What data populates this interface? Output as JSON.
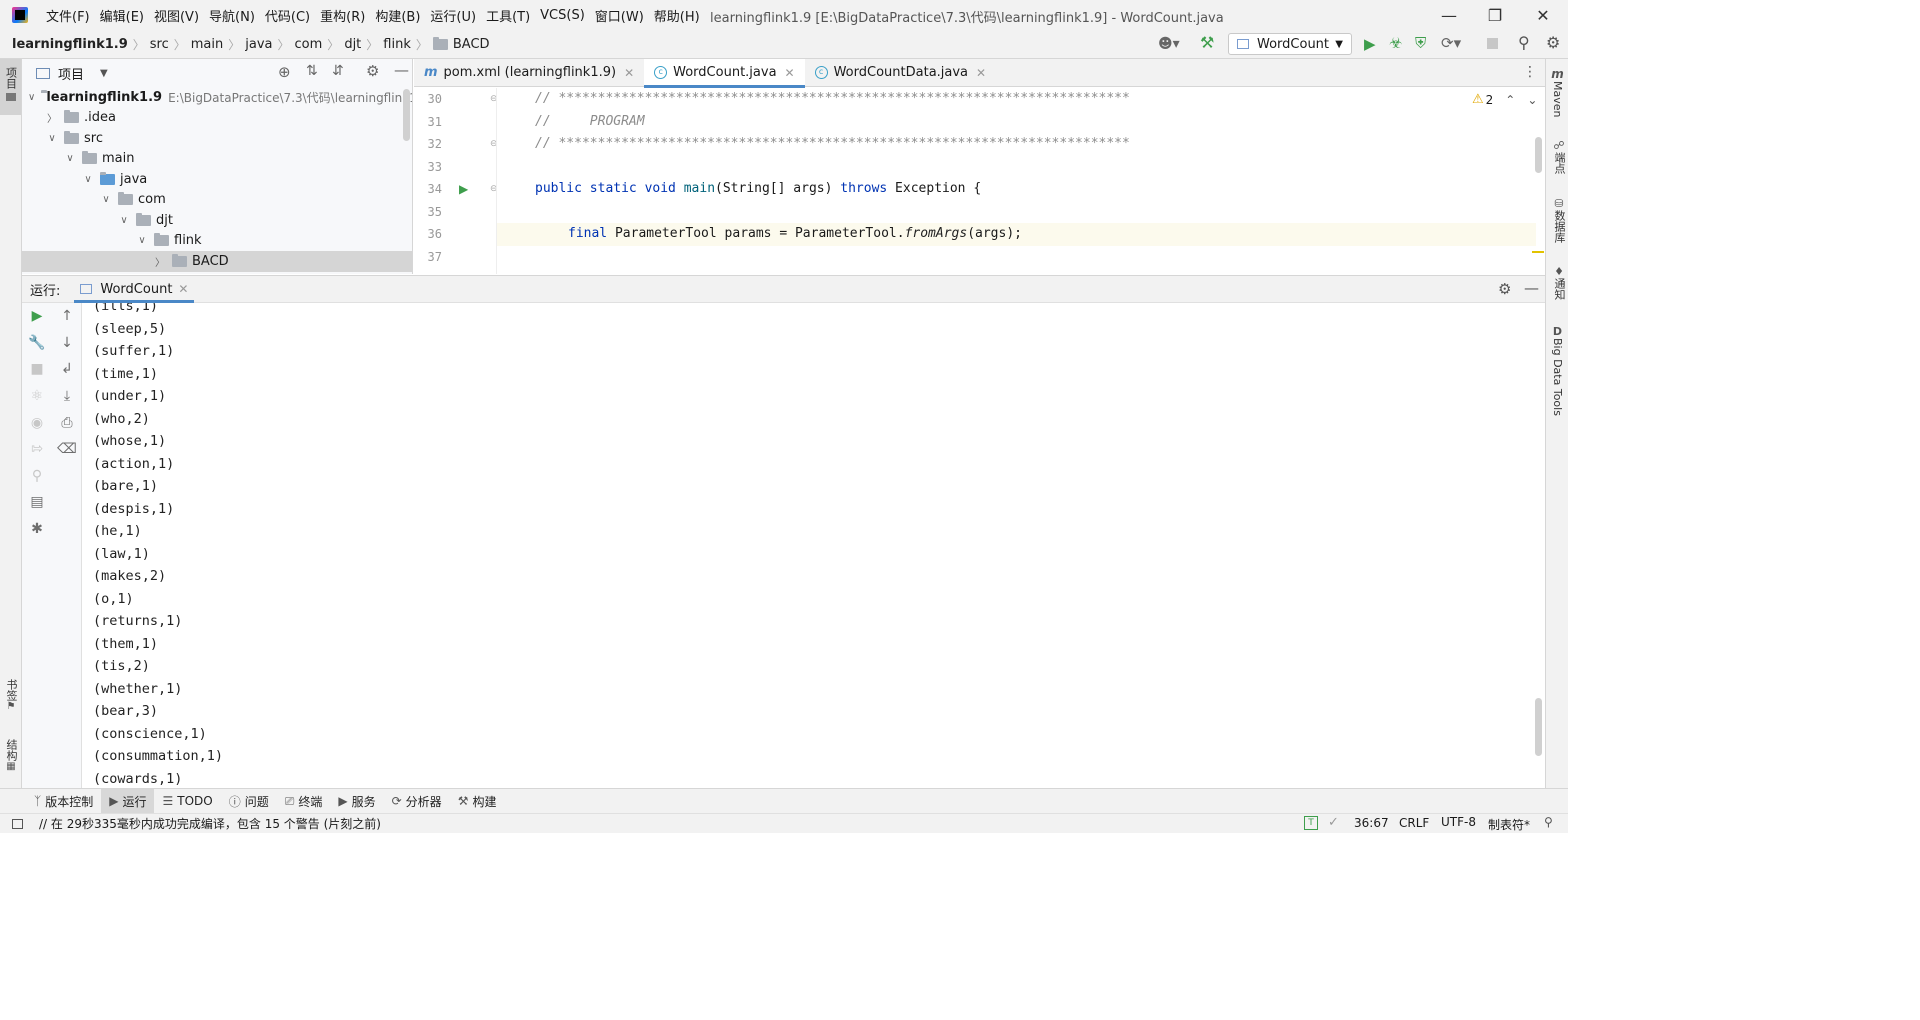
{
  "menu": [
    "文件(F)",
    "编辑(E)",
    "视图(V)",
    "导航(N)",
    "代码(C)",
    "重构(R)",
    "构建(B)",
    "运行(U)",
    "工具(T)",
    "VCS(S)",
    "窗口(W)",
    "帮助(H)"
  ],
  "window_title": "learningflink1.9 [E:\\BigDataPractice\\7.3\\代码\\learningflink1.9] - WordCount.java",
  "breadcrumb": [
    "learningflink1.9",
    "src",
    "main",
    "java",
    "com",
    "djt",
    "flink",
    "BACD"
  ],
  "run_config": "WordCount",
  "project_panel": {
    "title": "项目"
  },
  "tree": [
    {
      "label": "learningflink1.9",
      "path": "E:\\BigDataPractice\\7.3\\代码\\learningflink1",
      "level": 0,
      "chev": "v"
    },
    {
      "label": ".idea",
      "level": 1,
      "chev": ">"
    },
    {
      "label": "src",
      "level": 1,
      "chev": "v"
    },
    {
      "label": "main",
      "level": 2,
      "chev": "v"
    },
    {
      "label": "java",
      "level": 3,
      "chev": "v"
    },
    {
      "label": "com",
      "level": 4,
      "chev": "v"
    },
    {
      "label": "djt",
      "level": 5,
      "chev": "v"
    },
    {
      "label": "flink",
      "level": 6,
      "chev": "v"
    },
    {
      "label": "BACD",
      "level": 7,
      "chev": ">"
    }
  ],
  "tabs": [
    {
      "label": "pom.xml (learningflink1.9)",
      "icon": "m"
    },
    {
      "label": "WordCount.java",
      "icon": "c"
    },
    {
      "label": "WordCountData.java",
      "icon": "c"
    }
  ],
  "warnings_count": "2",
  "line_numbers": [
    "30",
    "31",
    "32",
    "33",
    "34",
    "35",
    "36",
    "37"
  ],
  "code": {
    "l30": "// *************************************************************************",
    "l31": "//     PROGRAM",
    "l32": "// *************************************************************************",
    "l34_kw": "public static void ",
    "l34_fn": "main",
    "l34_a": "(String[] args) ",
    "l34_kw2": "throws",
    "l34_b": " Exception {",
    "l36_kw": "final",
    "l36_a": " ParameterTool params = ParameterTool.",
    "l36_it": "fromArgs",
    "l36_b": "(args);"
  },
  "run": {
    "label": "运行:",
    "tab": "WordCount"
  },
  "output": [
    "(ills,1)",
    "(sleep,5)",
    "(suffer,1)",
    "(time,1)",
    "(under,1)",
    "(who,2)",
    "(whose,1)",
    "(action,1)",
    "(bare,1)",
    "(despis,1)",
    "(he,1)",
    "(law,1)",
    "(makes,2)",
    "(o,1)",
    "(returns,1)",
    "(them,1)",
    "(tis,2)",
    "(whether,1)",
    "(bear,3)",
    "(conscience,1)",
    "(consummation,1)",
    "(cowards,1)"
  ],
  "left_strip": {
    "project": "项目",
    "bookmarks": "书签",
    "structure": "结构"
  },
  "right_strip": [
    "Maven",
    "端点",
    "数据库",
    "通知",
    "Big Data Tools"
  ],
  "bottom_tabs": [
    "版本控制",
    "运行",
    "TODO",
    "问题",
    "终端",
    "服务",
    "分析器",
    "构建"
  ],
  "status": {
    "message": "// 在 29秒335毫秒内成功完成编译，包含 15 个警告 (片刻之前)",
    "position": "36:67",
    "line_sep": "CRLF",
    "encoding": "UTF-8",
    "indent": "制表符*"
  }
}
